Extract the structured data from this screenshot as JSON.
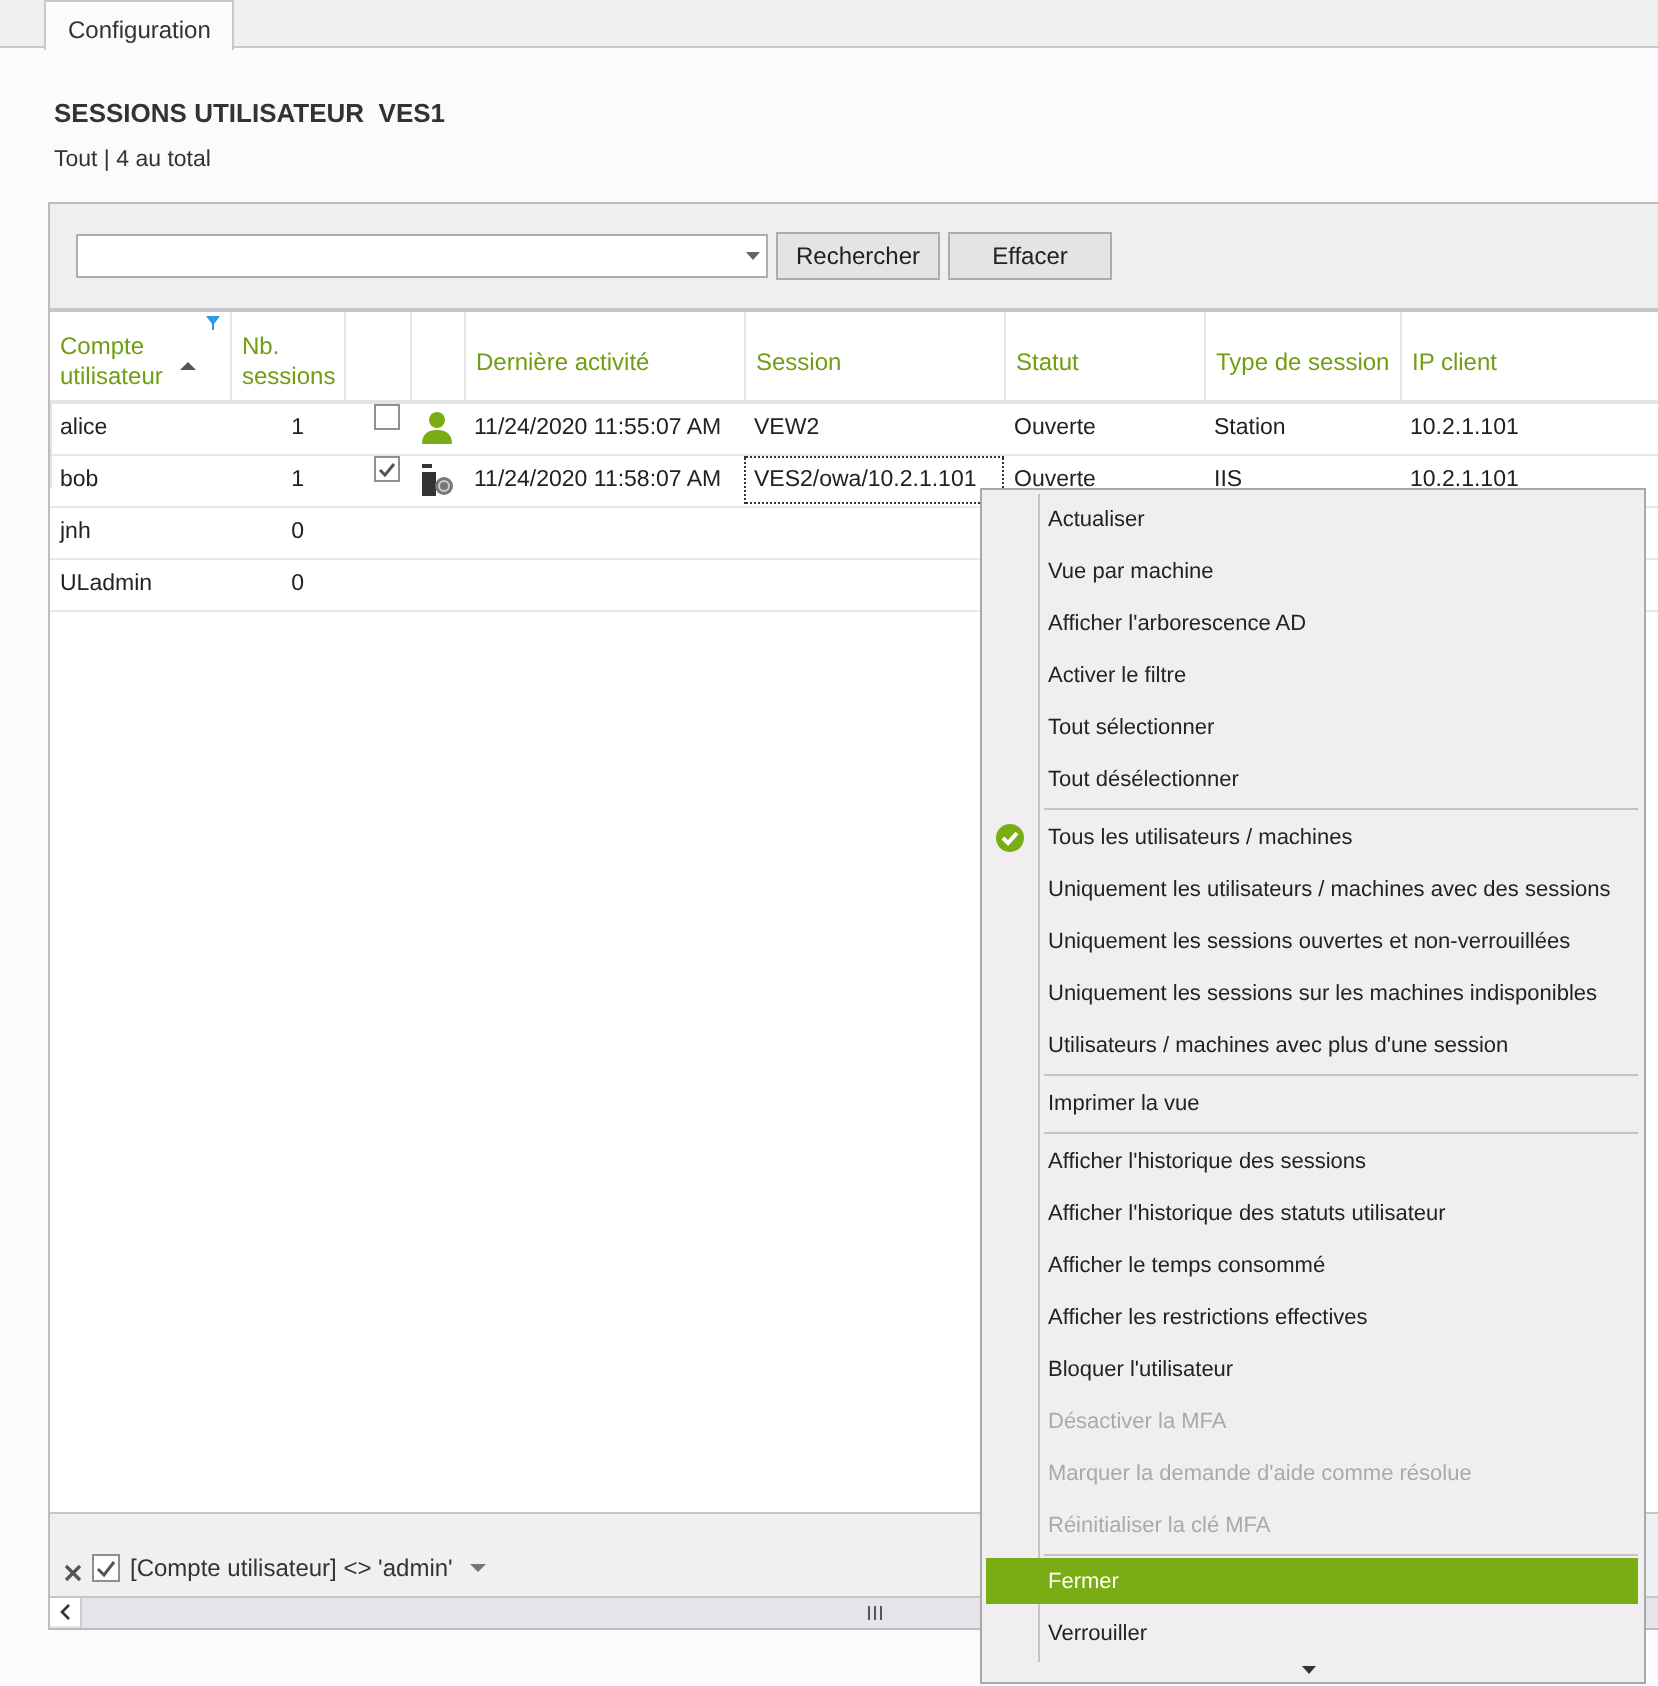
{
  "tabs": [
    {
      "label": "Configuration",
      "selected": true
    }
  ],
  "header": {
    "title": "SESSIONS UTILISATEUR  VES1",
    "subtitle": "Tout | 4 au total"
  },
  "toolbar": {
    "buttons": [
      "Rechercher",
      "Effacer"
    ]
  },
  "table": {
    "columns": [
      {
        "label": "Compte utilisateur",
        "sorted": true,
        "filtered": true
      },
      {
        "label": "Nb. sessions",
        "sorted": false,
        "filtered": false
      },
      {
        "label": "Dernière activité",
        "sorted": false,
        "filtered": false
      },
      {
        "label": "Session",
        "sorted": false,
        "filtered": false
      },
      {
        "label": "Statut",
        "sorted": false,
        "filtered": false
      },
      {
        "label": "Type de session",
        "sorted": false,
        "filtered": false
      },
      {
        "label": "IP client",
        "sorted": false,
        "filtered": false
      }
    ],
    "rows": [
      {
        "account": "alice",
        "sessions": "1",
        "checked": false,
        "kind": "user",
        "last_activity": "11/24/2020 11:55:07 AM",
        "session": "VEW2",
        "status": "Ouverte",
        "session_type": "Station",
        "client_ip": "10.2.1.101",
        "focused": false
      },
      {
        "account": "bob",
        "sessions": "1",
        "checked": true,
        "kind": "web",
        "last_activity": "11/24/2020 11:58:07 AM",
        "session": "VES2/owa/10.2.1.101",
        "status": "Ouverte",
        "session_type": "IIS",
        "client_ip": "10.2.1.101",
        "focused": true
      },
      {
        "account": "jnh",
        "sessions": "0"
      },
      {
        "account": "ULadmin",
        "sessions": "0"
      }
    ]
  },
  "filter_bar": {
    "text": "[Compte utilisateur] <> 'admin'",
    "enabled": true
  },
  "menu": {
    "items": [
      {
        "kind": "item",
        "label": "Actualiser",
        "checked": false,
        "disabled": false,
        "selected": false
      },
      {
        "kind": "item",
        "label": "Vue par machine",
        "checked": false,
        "disabled": false,
        "selected": false
      },
      {
        "kind": "item",
        "label": "Afficher l'arborescence AD",
        "checked": false,
        "disabled": false,
        "selected": false
      },
      {
        "kind": "item",
        "label": "Activer le filtre",
        "checked": false,
        "disabled": false,
        "selected": false
      },
      {
        "kind": "item",
        "label": "Tout sélectionner",
        "checked": false,
        "disabled": false,
        "selected": false
      },
      {
        "kind": "item",
        "label": "Tout désélectionner",
        "checked": false,
        "disabled": false,
        "selected": false
      },
      {
        "kind": "separator"
      },
      {
        "kind": "item",
        "label": "Tous les utilisateurs / machines",
        "checked": true,
        "disabled": false,
        "selected": false
      },
      {
        "kind": "item",
        "label": "Uniquement les utilisateurs / machines avec des sessions",
        "checked": false,
        "disabled": false,
        "selected": false
      },
      {
        "kind": "item",
        "label": "Uniquement les sessions ouvertes et non-verrouillées",
        "checked": false,
        "disabled": false,
        "selected": false
      },
      {
        "kind": "item",
        "label": "Uniquement les sessions sur les machines indisponibles",
        "checked": false,
        "disabled": false,
        "selected": false
      },
      {
        "kind": "item",
        "label": "Utilisateurs / machines avec plus d'une session",
        "checked": false,
        "disabled": false,
        "selected": false
      },
      {
        "kind": "separator"
      },
      {
        "kind": "item",
        "label": "Imprimer la vue",
        "checked": false,
        "disabled": false,
        "selected": false
      },
      {
        "kind": "separator"
      },
      {
        "kind": "item",
        "label": "Afficher l'historique des sessions",
        "checked": false,
        "disabled": false,
        "selected": false
      },
      {
        "kind": "item",
        "label": "Afficher l'historique des statuts utilisateur",
        "checked": false,
        "disabled": false,
        "selected": false
      },
      {
        "kind": "item",
        "label": "Afficher le temps consommé",
        "checked": false,
        "disabled": false,
        "selected": false
      },
      {
        "kind": "item",
        "label": "Afficher les restrictions effectives",
        "checked": false,
        "disabled": false,
        "selected": false
      },
      {
        "kind": "item",
        "label": "Bloquer l'utilisateur",
        "checked": false,
        "disabled": false,
        "selected": false
      },
      {
        "kind": "item",
        "label": "Désactiver la MFA",
        "checked": false,
        "disabled": true,
        "selected": false
      },
      {
        "kind": "item",
        "label": "Marquer la demande d'aide comme résolue",
        "checked": false,
        "disabled": true,
        "selected": false
      },
      {
        "kind": "item",
        "label": "Réinitialiser la clé MFA",
        "checked": false,
        "disabled": true,
        "selected": false
      },
      {
        "kind": "separator"
      },
      {
        "kind": "item",
        "label": "Fermer",
        "checked": false,
        "disabled": false,
        "selected": true
      },
      {
        "kind": "item",
        "label": "Verrouiller",
        "checked": false,
        "disabled": false,
        "selected": false
      }
    ]
  }
}
